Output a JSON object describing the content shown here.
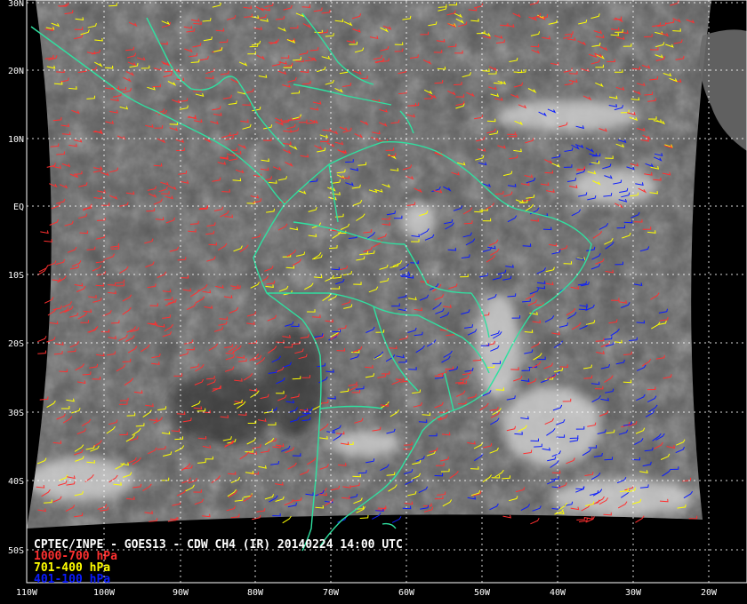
{
  "title": "CPTEC/INPE - GOES13 - CDW CH4 (IR) 20140224 14:00 UTC",
  "legend": [
    {
      "label": "1000-700 hPa",
      "color": "#ff3030"
    },
    {
      "label": "701-400 hPa",
      "color": "#ffff00"
    },
    {
      "label": "401-100 hPa",
      "color": "#0a1cff"
    }
  ],
  "lat_labels": [
    "30N",
    "20N",
    "10N",
    "EQ",
    "10S",
    "20S",
    "30S",
    "40S",
    "50S"
  ],
  "lon_labels": [
    "110W",
    "100W",
    "90W",
    "80W",
    "70W",
    "60W",
    "50W",
    "40W",
    "30W",
    "20W"
  ],
  "colors": {
    "background": "#000000",
    "coastline": "#2fe0a0",
    "grid": "#ffffff",
    "text": "#ffffff"
  }
}
